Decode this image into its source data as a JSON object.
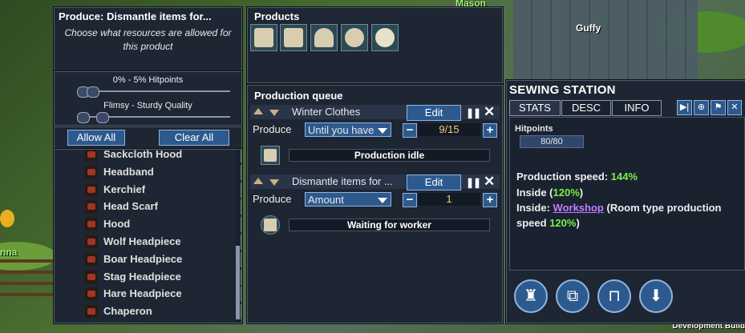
{
  "world": {
    "name_tags": [
      "Mason",
      "Guffy",
      "nna"
    ],
    "dev_build": "Development Build"
  },
  "filter_panel": {
    "title": "Produce: Dismantle items for...",
    "description": "Choose what resources are allowed for this product",
    "hitpoints_slider": {
      "label": "0% - 5% Hitpoints",
      "low": 0,
      "high": 5
    },
    "quality_slider": {
      "label": "Flimsy - Sturdy Quality"
    },
    "allow_all": "Allow All",
    "clear_all": "Clear All",
    "items": [
      {
        "label": "Sackcloth Hood",
        "checked": true
      },
      {
        "label": "Headband",
        "checked": true
      },
      {
        "label": "Kerchief",
        "checked": true
      },
      {
        "label": "Head Scarf",
        "checked": true
      },
      {
        "label": "Hood",
        "checked": true
      },
      {
        "label": "Wolf Headpiece",
        "checked": true
      },
      {
        "label": "Boar Headpiece",
        "checked": true
      },
      {
        "label": "Stag Headpiece",
        "checked": true
      },
      {
        "label": "Hare Headpiece",
        "checked": true
      },
      {
        "label": "Chaperon",
        "checked": true
      }
    ],
    "check_glyph": "✔"
  },
  "products": {
    "title": "Products",
    "slots": [
      "vest-icon",
      "tunic-icon",
      "cap-icon",
      "hat-icon",
      "dismantle-icon"
    ]
  },
  "queue": {
    "title": "Production queue",
    "items": [
      {
        "name": "Winter Clothes",
        "edit": "Edit",
        "produce_label": "Produce",
        "mode": "Until you have",
        "count": "9/15",
        "status": "Production idle",
        "icon": "vest-icon"
      },
      {
        "name": "Dismantle items for ...",
        "edit": "Edit",
        "produce_label": "Produce",
        "mode": "Amount",
        "count": "1",
        "status": "Waiting for worker",
        "icon": "dismantle-icon"
      }
    ],
    "pause_glyph": "❚❚",
    "close_glyph": "✕",
    "minus": "−",
    "plus": "+"
  },
  "station": {
    "title": "SEWING STATION",
    "tabs": [
      "STATS",
      "DESC",
      "INFO"
    ],
    "active_tab": "STATS",
    "hitpoints_label": "Hitpoints",
    "hitpoints_value": "80/80",
    "prod_speed_label": "Production speed:",
    "prod_speed_value": "144%",
    "inside_label": "Inside (",
    "inside_value": "120%",
    "inside_close": ")",
    "inside2_label": "Inside:",
    "workshop_link": "Workshop",
    "room_text": "(Room type production",
    "speed_label": "speed",
    "speed_value": "120%",
    "speed_close": ")",
    "tool_icons": [
      "next-icon",
      "target-icon",
      "priority-icon",
      "close-icon"
    ],
    "tool_glyphs": [
      "▶|",
      "⊕",
      "⚑",
      "✕"
    ],
    "actions": [
      {
        "name": "tower-icon",
        "glyph": "♜"
      },
      {
        "name": "copy-icon",
        "glyph": "⧉"
      },
      {
        "name": "workbench-icon",
        "glyph": "⊓"
      },
      {
        "name": "storage-icon",
        "glyph": "⬇"
      }
    ]
  },
  "colors": {
    "panel_bg": "#1e2633",
    "button_blue": "#2d5a8e",
    "accent_green": "#7af048",
    "link_purple": "#c07cff"
  }
}
